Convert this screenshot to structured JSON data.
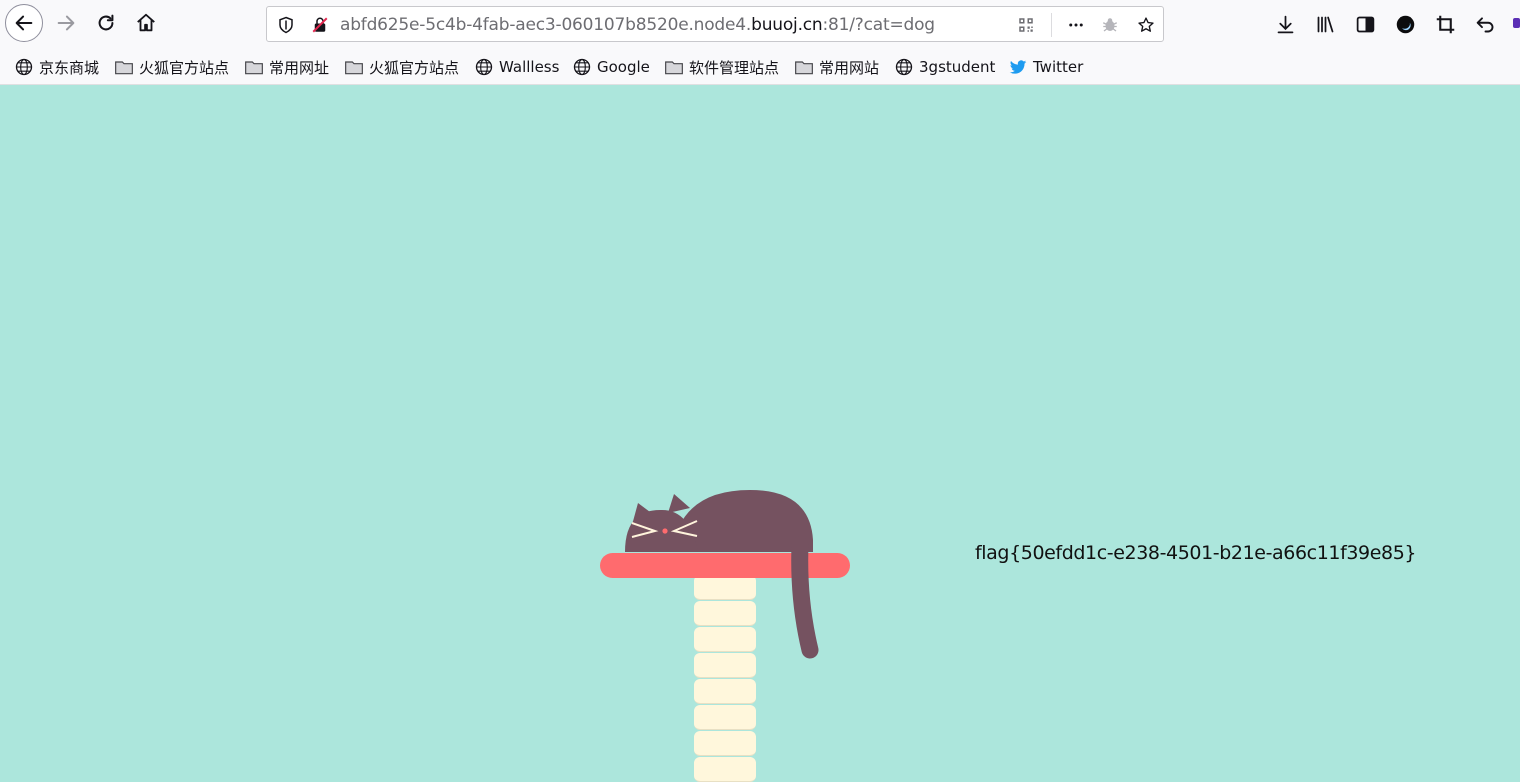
{
  "browser": {
    "url": {
      "prefix": "abfd625e-5c4b-4fab-aec3-060107b8520e.node4.",
      "domain": "buuoj.cn",
      "suffix": ":81/?cat=dog"
    },
    "bookmarks": [
      {
        "label": "京东商城",
        "icon": "globe-icon"
      },
      {
        "label": "火狐官方站点",
        "icon": "folder-icon"
      },
      {
        "label": "常用网址",
        "icon": "folder-icon"
      },
      {
        "label": "火狐官方站点",
        "icon": "folder-icon"
      },
      {
        "label": "Wallless",
        "icon": "globe-icon"
      },
      {
        "label": "Google",
        "icon": "globe-icon"
      },
      {
        "label": "软件管理站点",
        "icon": "folder-icon"
      },
      {
        "label": "常用网站",
        "icon": "folder-icon"
      },
      {
        "label": "3gstudent",
        "icon": "globe-icon"
      },
      {
        "label": "Twitter",
        "icon": "twitter-icon"
      }
    ]
  },
  "page": {
    "flag_text": "flag{50efdd1c-e238-4501-b21e-a66c11f39e85}",
    "colors": {
      "background": "#ace6dc",
      "shelf": "#ff6b6e",
      "post": "#fff7dc",
      "cat": "#755260"
    }
  }
}
